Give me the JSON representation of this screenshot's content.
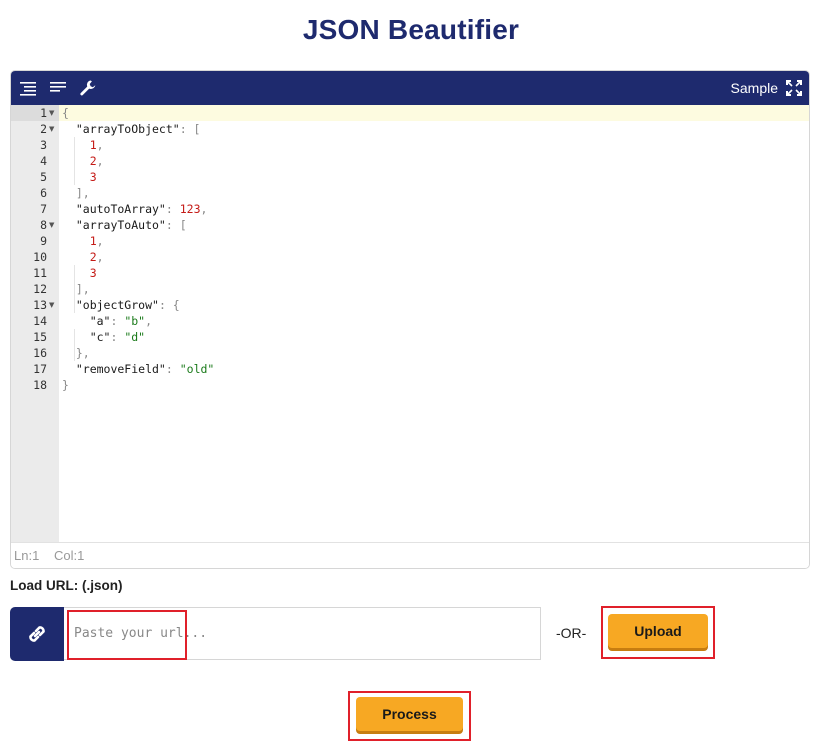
{
  "page": {
    "title": "JSON Beautifier"
  },
  "toolbar": {
    "sample_label": "Sample"
  },
  "editor": {
    "line_numbers": [
      "1",
      "2",
      "3",
      "4",
      "5",
      "6",
      "7",
      "8",
      "9",
      "10",
      "11",
      "12",
      "13",
      "14",
      "15",
      "16",
      "17",
      "18"
    ],
    "status": {
      "ln": "Ln:1",
      "col": "Col:1"
    }
  },
  "code_lines": [
    [
      {
        "t": "{",
        "c": "punc"
      }
    ],
    [
      {
        "t": "  \"arrayToObject\"",
        "c": "key"
      },
      {
        "t": ": [",
        "c": "punc"
      }
    ],
    [
      {
        "t": "    1",
        "c": "num"
      },
      {
        "t": ",",
        "c": "punc"
      }
    ],
    [
      {
        "t": "    2",
        "c": "num"
      },
      {
        "t": ",",
        "c": "punc"
      }
    ],
    [
      {
        "t": "    3",
        "c": "num"
      }
    ],
    [
      {
        "t": "  ],",
        "c": "punc"
      }
    ],
    [
      {
        "t": "  \"autoToArray\"",
        "c": "key"
      },
      {
        "t": ": ",
        "c": "punc"
      },
      {
        "t": "123",
        "c": "num"
      },
      {
        "t": ",",
        "c": "punc"
      }
    ],
    [
      {
        "t": "  \"arrayToAuto\"",
        "c": "key"
      },
      {
        "t": ": [",
        "c": "punc"
      }
    ],
    [
      {
        "t": "    1",
        "c": "num"
      },
      {
        "t": ",",
        "c": "punc"
      }
    ],
    [
      {
        "t": "    2",
        "c": "num"
      },
      {
        "t": ",",
        "c": "punc"
      }
    ],
    [
      {
        "t": "    3",
        "c": "num"
      }
    ],
    [
      {
        "t": "  ],",
        "c": "punc"
      }
    ],
    [
      {
        "t": "  \"objectGrow\"",
        "c": "key"
      },
      {
        "t": ": {",
        "c": "punc"
      }
    ],
    [
      {
        "t": "    \"a\"",
        "c": "key"
      },
      {
        "t": ": ",
        "c": "punc"
      },
      {
        "t": "\"b\"",
        "c": "str"
      },
      {
        "t": ",",
        "c": "punc"
      }
    ],
    [
      {
        "t": "    \"c\"",
        "c": "key"
      },
      {
        "t": ": ",
        "c": "punc"
      },
      {
        "t": "\"d\"",
        "c": "str"
      }
    ],
    [
      {
        "t": "  },",
        "c": "punc"
      }
    ],
    [
      {
        "t": "  \"removeField\"",
        "c": "key"
      },
      {
        "t": ": ",
        "c": "punc"
      },
      {
        "t": "\"old\"",
        "c": "str"
      }
    ],
    [
      {
        "t": "}",
        "c": "punc"
      }
    ]
  ],
  "fold_lines": [
    2,
    8,
    13
  ],
  "load_url": {
    "label": "Load URL: (.json)",
    "placeholder": "Paste your url...",
    "value": ""
  },
  "or_text": "-OR-",
  "buttons": {
    "upload": "Upload",
    "process": "Process"
  },
  "colors": {
    "brand": "#1e2a6e",
    "button": "#f7a823",
    "highlight": "#e0202a"
  },
  "icons": [
    "indent-icon",
    "compact-icon",
    "wrench-icon",
    "fullscreen-icon",
    "wrap-icon",
    "link-icon"
  ]
}
